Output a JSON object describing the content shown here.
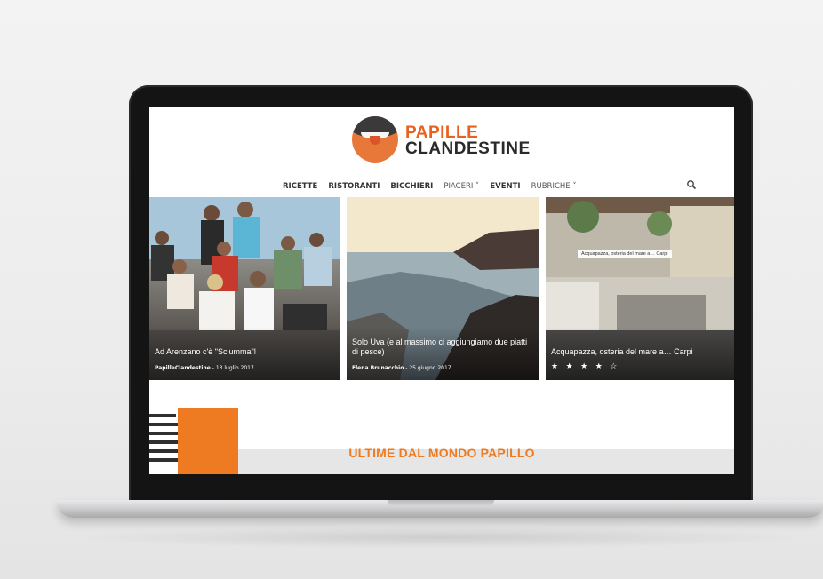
{
  "site": {
    "logo": {
      "line1": "PAPILLE",
      "line2": "CLANDESTINE"
    },
    "nav": [
      {
        "label": "RICETTE",
        "dropdown": false
      },
      {
        "label": "RISTORANTI",
        "dropdown": false
      },
      {
        "label": "BICCHIERI",
        "dropdown": false
      },
      {
        "label": "PIACERI ˅",
        "dropdown": true
      },
      {
        "label": "EVENTI",
        "dropdown": false
      },
      {
        "label": "RUBRICHE ˅",
        "dropdown": true
      }
    ],
    "search_icon": "search-icon",
    "featured": [
      {
        "title": "Ad Arenzano c'è \"Sciumma\"!",
        "author": "PapilleClandestine",
        "date": "13 luglio 2017"
      },
      {
        "title": "Solo Uva (e al massimo ci aggiungiamo due piatti di pesce)",
        "author": "Elena Brunacchio",
        "date": "25 giugno 2017"
      },
      {
        "title": "Acquapazza, osteria del mare a… Carpi",
        "tag": "Acquapazza, osteria del mare a… Carpi",
        "stars": "★ ★ ★ ★ ☆"
      }
    ],
    "section_title": "ULTIME DAL MONDO PAPILLO"
  },
  "colors": {
    "accent": "#ee7b21",
    "logo_orange": "#e8621f",
    "dark": "#2a2a2a"
  }
}
